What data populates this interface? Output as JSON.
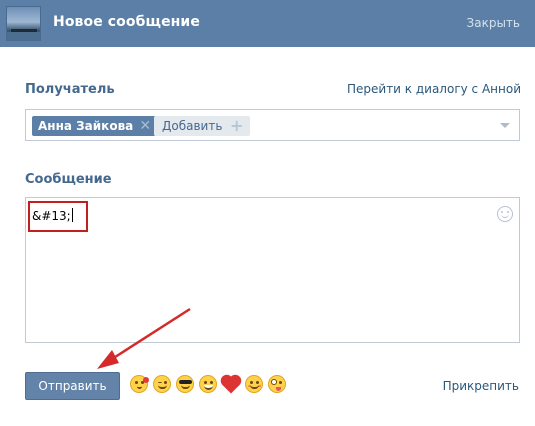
{
  "header": {
    "title": "Новое сообщение",
    "close_label": "Закрыть",
    "avatar_icon": "landscape-avatar-icon",
    "background_color": "#5b7fa6"
  },
  "recipient": {
    "label": "Получатель",
    "dialog_link": "Перейти к диалогу с Анной",
    "chip_name": "Анна Зайкова",
    "add_label": "Добавить"
  },
  "message": {
    "label": "Сообщение",
    "value": "&#13;",
    "emoji_button_icon": "smile-icon"
  },
  "footer": {
    "send_label": "Отправить",
    "attach_label": "Прикрепить",
    "emojis": [
      "kiss-emoji",
      "wink-emoji",
      "sunglasses-emoji",
      "grin-emoji",
      "heart-emoji",
      "blush-emoji",
      "crazy-emoji"
    ]
  },
  "annotations": {
    "highlight_color": "#c41f1f",
    "arrow_color": "#d42a2a"
  }
}
